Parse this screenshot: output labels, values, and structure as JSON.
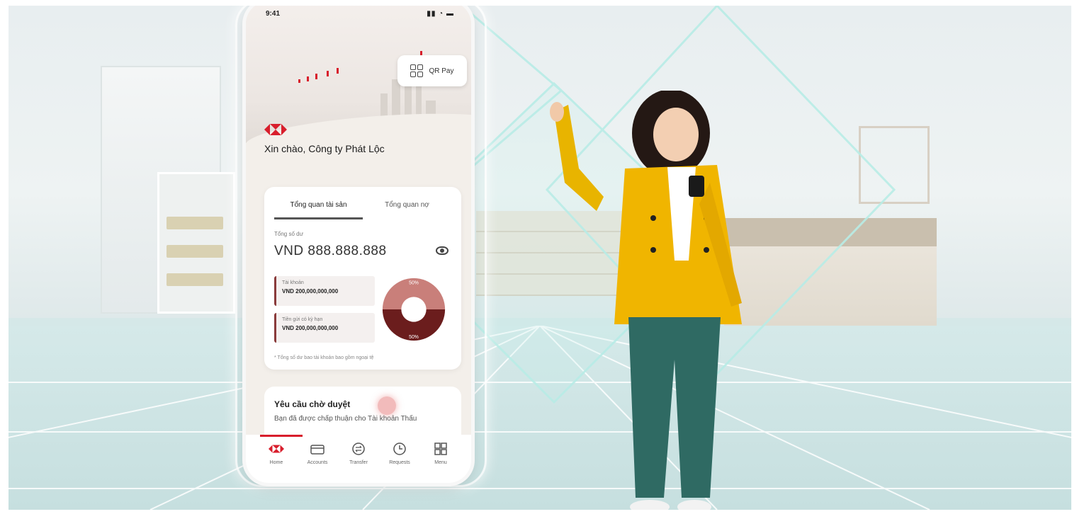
{
  "phone": {
    "status_time": "9:41",
    "qr_pay_label": "QR Pay",
    "greeting": "Xin chào, Công ty Phát Lộc",
    "tabs": [
      {
        "label": "Tổng quan tài sản",
        "active": true
      },
      {
        "label": "Tổng quan nợ",
        "active": false
      }
    ],
    "balance_label": "Tổng số dư",
    "balance_value": "VND 888.888.888",
    "accounts": [
      {
        "label": "Tài khoản",
        "value": "VND 200,000,000,000"
      },
      {
        "label": "Tiền gửi có kỳ hạn",
        "value": "VND 200,000,000,000"
      }
    ],
    "donut": {
      "top_percent_label": "50%",
      "bottom_percent_label": "50%",
      "top_color": "#c97f7a",
      "bottom_color": "#6b1d1d"
    },
    "note": "* Tổng số dư bao tài khoản bao gồm ngoại tệ",
    "pending": {
      "title": "Yêu cầu chờ duyệt",
      "desc": "Bạn đã được chấp thuận cho Tài khoản Thấu"
    },
    "nav": [
      {
        "label": "Home",
        "icon": "home-logo-icon"
      },
      {
        "label": "Accounts",
        "icon": "wallet-icon"
      },
      {
        "label": "Transfer",
        "icon": "transfer-icon"
      },
      {
        "label": "Requests",
        "icon": "clock-icon"
      },
      {
        "label": "Menu",
        "icon": "grid-icon"
      }
    ]
  },
  "colors": {
    "brand_red": "#d81e2c",
    "background_teal": "#cfe6e6"
  }
}
